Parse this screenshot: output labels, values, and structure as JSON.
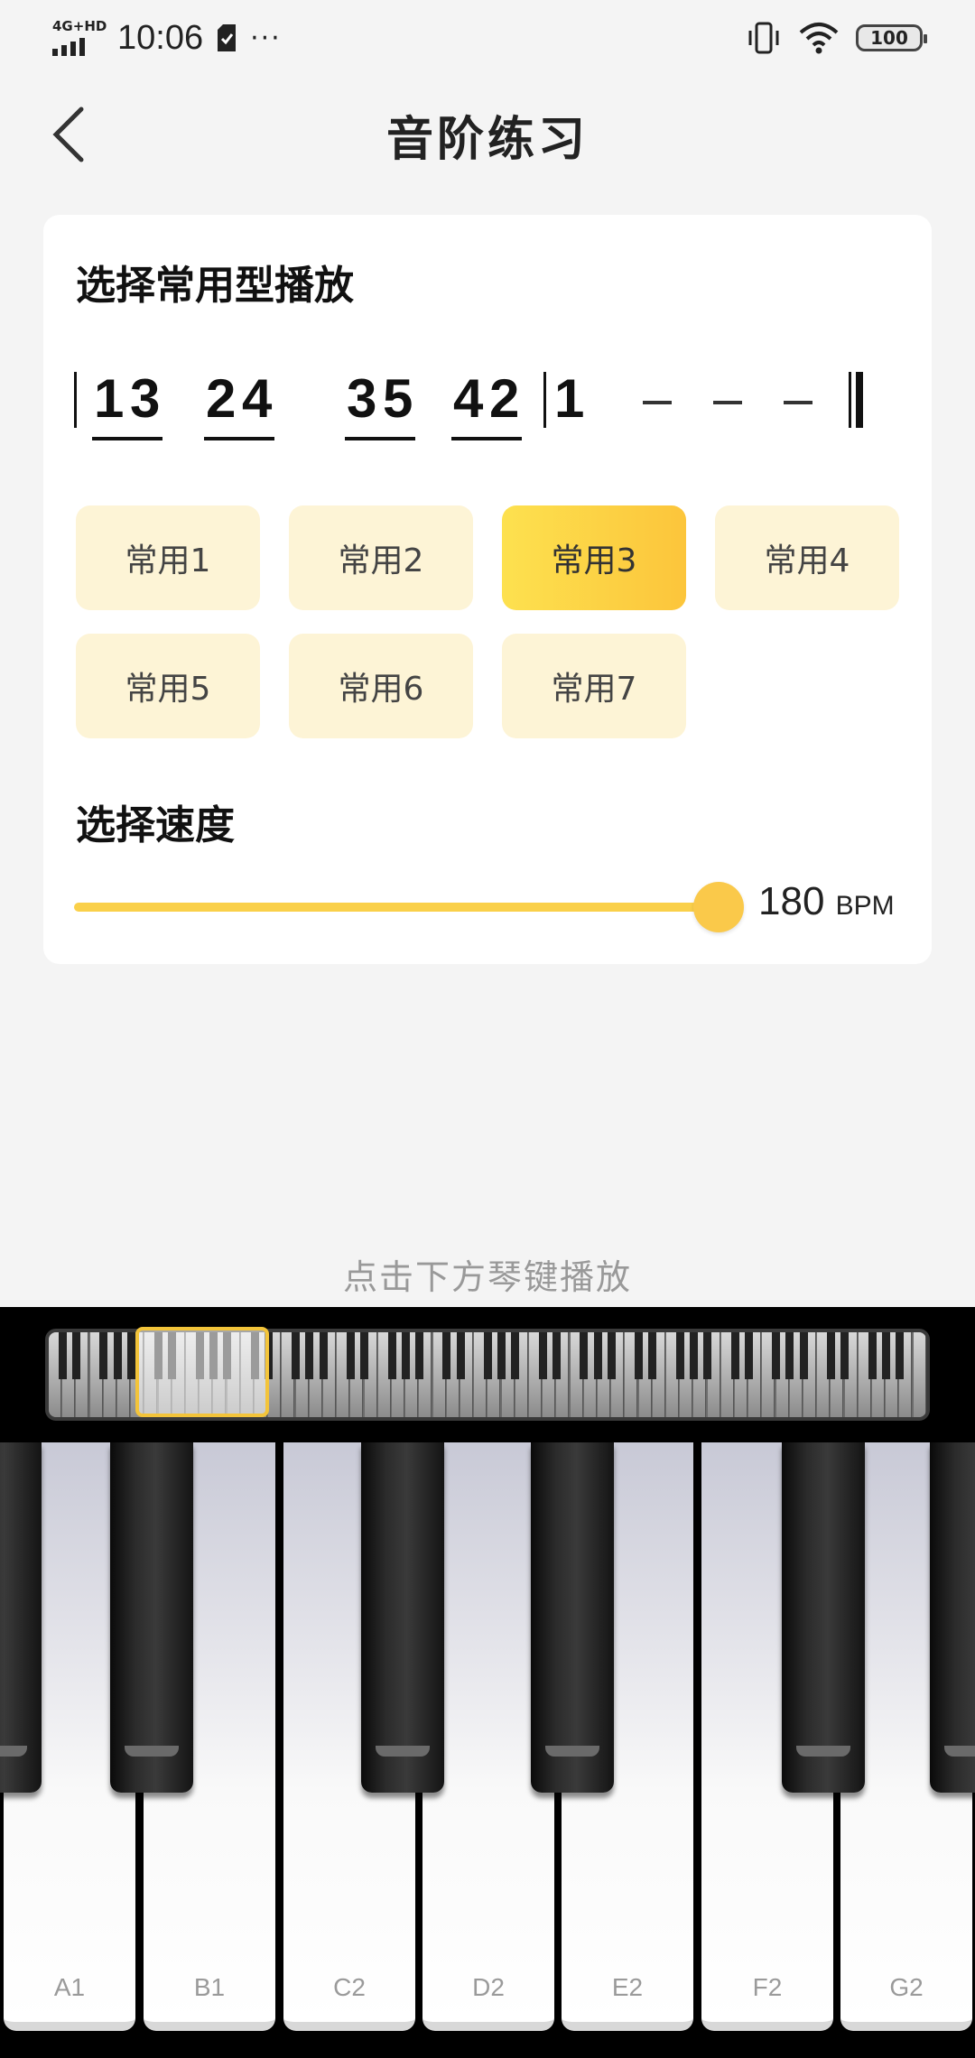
{
  "status_bar": {
    "network": "4G+HD",
    "time": "10:06",
    "more": "···",
    "battery": "100"
  },
  "header": {
    "title": "音阶练习"
  },
  "card": {
    "pattern_section_title": "选择常用型播放",
    "notation": {
      "notes": [
        "1",
        "3",
        "2",
        "4",
        "3",
        "5",
        "4",
        "2",
        "1"
      ]
    },
    "patterns": [
      {
        "label": "常用1",
        "selected": false
      },
      {
        "label": "常用2",
        "selected": false
      },
      {
        "label": "常用3",
        "selected": true
      },
      {
        "label": "常用4",
        "selected": false
      },
      {
        "label": "常用5",
        "selected": false
      },
      {
        "label": "常用6",
        "selected": false
      },
      {
        "label": "常用7",
        "selected": false
      }
    ],
    "speed_section_title": "选择速度",
    "speed": {
      "value": "180",
      "unit": "BPM",
      "fraction": 1.0
    }
  },
  "hint": "点击下方琴键播放",
  "piano": {
    "white_keys": [
      "A1",
      "B1",
      "C2",
      "D2",
      "E2",
      "F2",
      "G2"
    ],
    "colors": {
      "accent": "#fcc53b",
      "accent_light": "#fdf4d6"
    }
  }
}
